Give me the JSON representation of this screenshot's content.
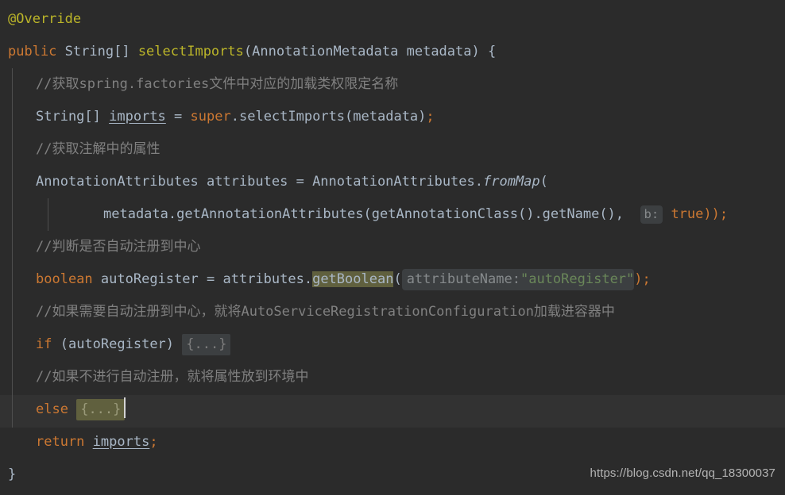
{
  "editor": {
    "theme_name": "darcula",
    "background": "#2b2b2b",
    "caret_line_background": "#323232",
    "default_text_color": "#a9b7c6",
    "colors": {
      "annotation": "#bbb529",
      "keyword": "#cc7832",
      "comment": "#808080",
      "string": "#6a8759",
      "identifier": "#a9b7c6",
      "inlay_hint_bg": "#3c3f41",
      "inlay_hint_fg": "#868a8c",
      "highlight_olive": "#60603e",
      "fold_bg": "#3c3f41",
      "indent_guide": "#4e4e4e",
      "caret": "#d4d4d4"
    },
    "language": "Java"
  },
  "code": {
    "line01": {
      "annotation": "@Override"
    },
    "line02": {
      "kw_public": "public",
      "type_string_array": "String[]",
      "method_name": "selectImports",
      "paren_open": "(",
      "param_type": "AnnotationMetadata",
      "param_name": "metadata",
      "paren_close": ")",
      "brace_open": "{"
    },
    "line03": {
      "comment": "//获取spring.factories文件中对应的加载类权限定名称"
    },
    "line04": {
      "type": "String[]",
      "var": "imports",
      "equals": "=",
      "kw_super": "super",
      "dot": ".",
      "call": "selectImports",
      "args": "(metadata)",
      "semi": ";"
    },
    "line05": {
      "comment": "//获取注解中的属性"
    },
    "line06": {
      "type": "AnnotationAttributes",
      "var": "attributes",
      "equals": "=",
      "class_ref": "AnnotationAttributes.",
      "static_method": "fromMap",
      "paren_open": "("
    },
    "line07": {
      "expr": "metadata.getAnnotationAttributes(getAnnotationClass().getName(),",
      "hint_b": "b:",
      "value_true": "true",
      "tail": "));"
    },
    "line08": {
      "comment": "//判断是否自动注册到中心"
    },
    "line09": {
      "kw_boolean": "boolean",
      "var": "autoRegister",
      "equals": "=",
      "receiver": "attributes.",
      "highlighted_method": "getBoolean",
      "paren_open": "(",
      "hint_attribute_name": "attributeName:",
      "string_literal": "\"autoRegister\"",
      "tail": ");"
    },
    "line10": {
      "comment": "//如果需要自动注册到中心，就将AutoServiceRegistrationConfiguration加载进容器中"
    },
    "line11": {
      "kw_if": "if",
      "condition": "(autoRegister)",
      "folded_block": "{...}"
    },
    "line12": {
      "comment": "//如果不进行自动注册，就将属性放到环境中"
    },
    "line13": {
      "kw_else": "else",
      "folded_block": "{...}"
    },
    "line14": {
      "kw_return": "return",
      "var": "imports",
      "semi": ";"
    },
    "line15": {
      "brace_close": "}"
    }
  },
  "watermark": {
    "text": "https://blog.csdn.net/qq_18300037"
  }
}
